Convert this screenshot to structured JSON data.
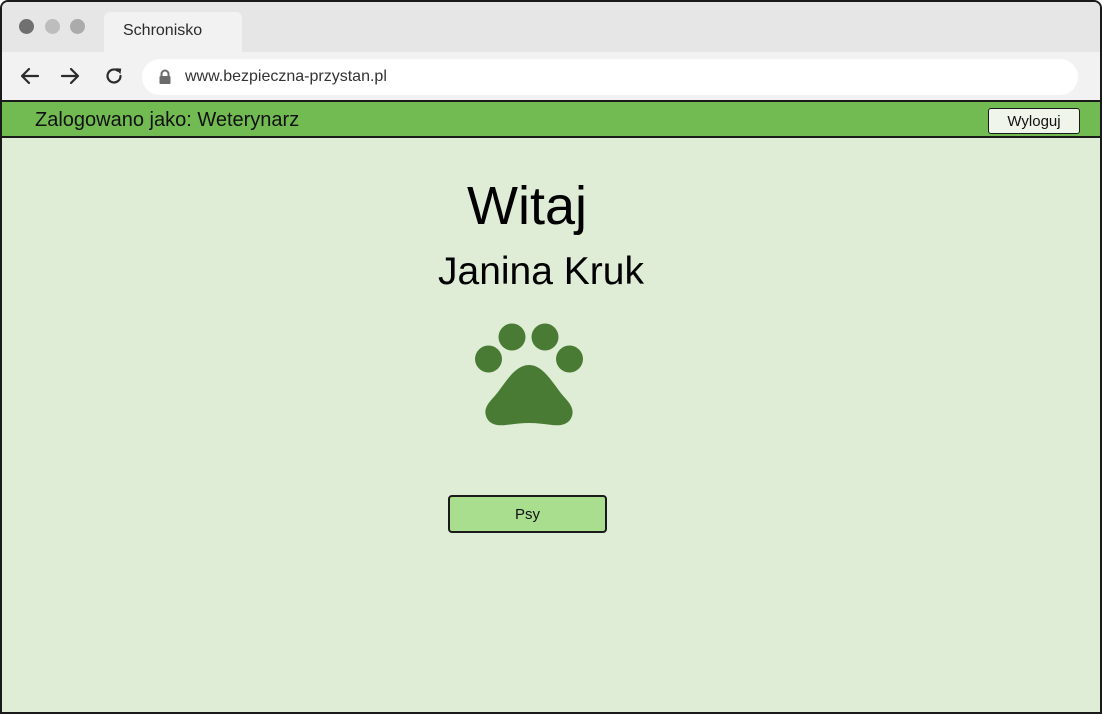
{
  "browser": {
    "tab_title": "Schronisko",
    "url": "www.bezpieczna-przystan.pl"
  },
  "header": {
    "logged_in_label": "Zalogowano jako: Weterynarz",
    "logout_label": "Wyloguj"
  },
  "main": {
    "greeting": "Witaj",
    "user_name": "Janina Kruk",
    "logo_icon": "paw-icon",
    "dogs_button_label": "Psy"
  },
  "colors": {
    "header_green": "#72bb53",
    "page_background": "#dfedd6",
    "button_green": "#aade8f",
    "paw_green": "#4a7b34"
  }
}
